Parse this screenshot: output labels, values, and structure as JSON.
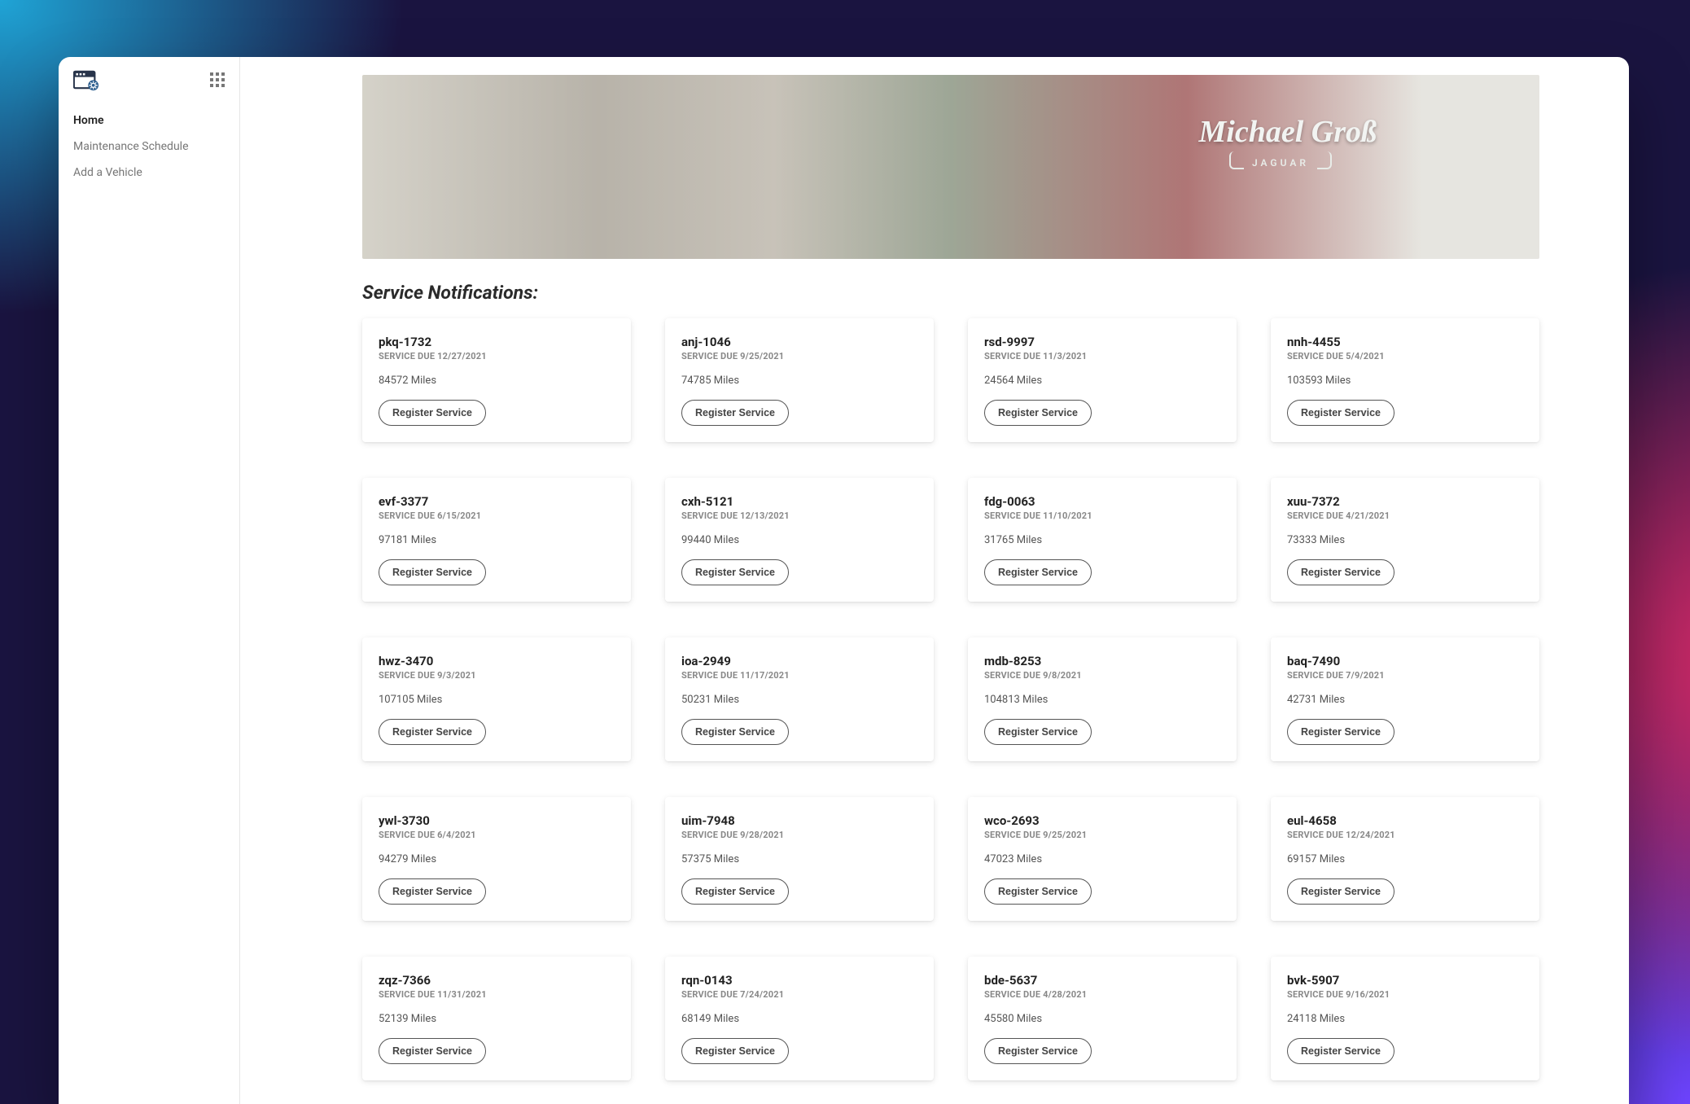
{
  "sidebar": {
    "items": [
      {
        "label": "Home",
        "active": true
      },
      {
        "label": "Maintenance Schedule",
        "active": false
      },
      {
        "label": "Add a Vehicle",
        "active": false
      }
    ]
  },
  "hero": {
    "headline": "Michael Groß",
    "brand": "JAGUAR"
  },
  "main": {
    "section_title": "Service Notifications:",
    "due_prefix": "SERVICE DUE ",
    "miles_suffix": " Miles",
    "button_label": "Register Service",
    "cards": [
      {
        "id": "pkq-1732",
        "due": "12/27/2021",
        "miles": "84572"
      },
      {
        "id": "anj-1046",
        "due": "9/25/2021",
        "miles": "74785"
      },
      {
        "id": "rsd-9997",
        "due": "11/3/2021",
        "miles": "24564"
      },
      {
        "id": "nnh-4455",
        "due": "5/4/2021",
        "miles": "103593"
      },
      {
        "id": "evf-3377",
        "due": "6/15/2021",
        "miles": "97181"
      },
      {
        "id": "cxh-5121",
        "due": "12/13/2021",
        "miles": "99440"
      },
      {
        "id": "fdg-0063",
        "due": "11/10/2021",
        "miles": "31765"
      },
      {
        "id": "xuu-7372",
        "due": "4/21/2021",
        "miles": "73333"
      },
      {
        "id": "hwz-3470",
        "due": "9/3/2021",
        "miles": "107105"
      },
      {
        "id": "ioa-2949",
        "due": "11/17/2021",
        "miles": "50231"
      },
      {
        "id": "mdb-8253",
        "due": "9/8/2021",
        "miles": "104813"
      },
      {
        "id": "baq-7490",
        "due": "7/9/2021",
        "miles": "42731"
      },
      {
        "id": "ywl-3730",
        "due": "6/4/2021",
        "miles": "94279"
      },
      {
        "id": "uim-7948",
        "due": "9/28/2021",
        "miles": "57375"
      },
      {
        "id": "wco-2693",
        "due": "9/25/2021",
        "miles": "47023"
      },
      {
        "id": "eul-4658",
        "due": "12/24/2021",
        "miles": "69157"
      },
      {
        "id": "zqz-7366",
        "due": "11/31/2021",
        "miles": "52139"
      },
      {
        "id": "rqn-0143",
        "due": "7/24/2021",
        "miles": "68149"
      },
      {
        "id": "bde-5637",
        "due": "4/28/2021",
        "miles": "45580"
      },
      {
        "id": "bvk-5907",
        "due": "9/16/2021",
        "miles": "24118"
      }
    ]
  }
}
